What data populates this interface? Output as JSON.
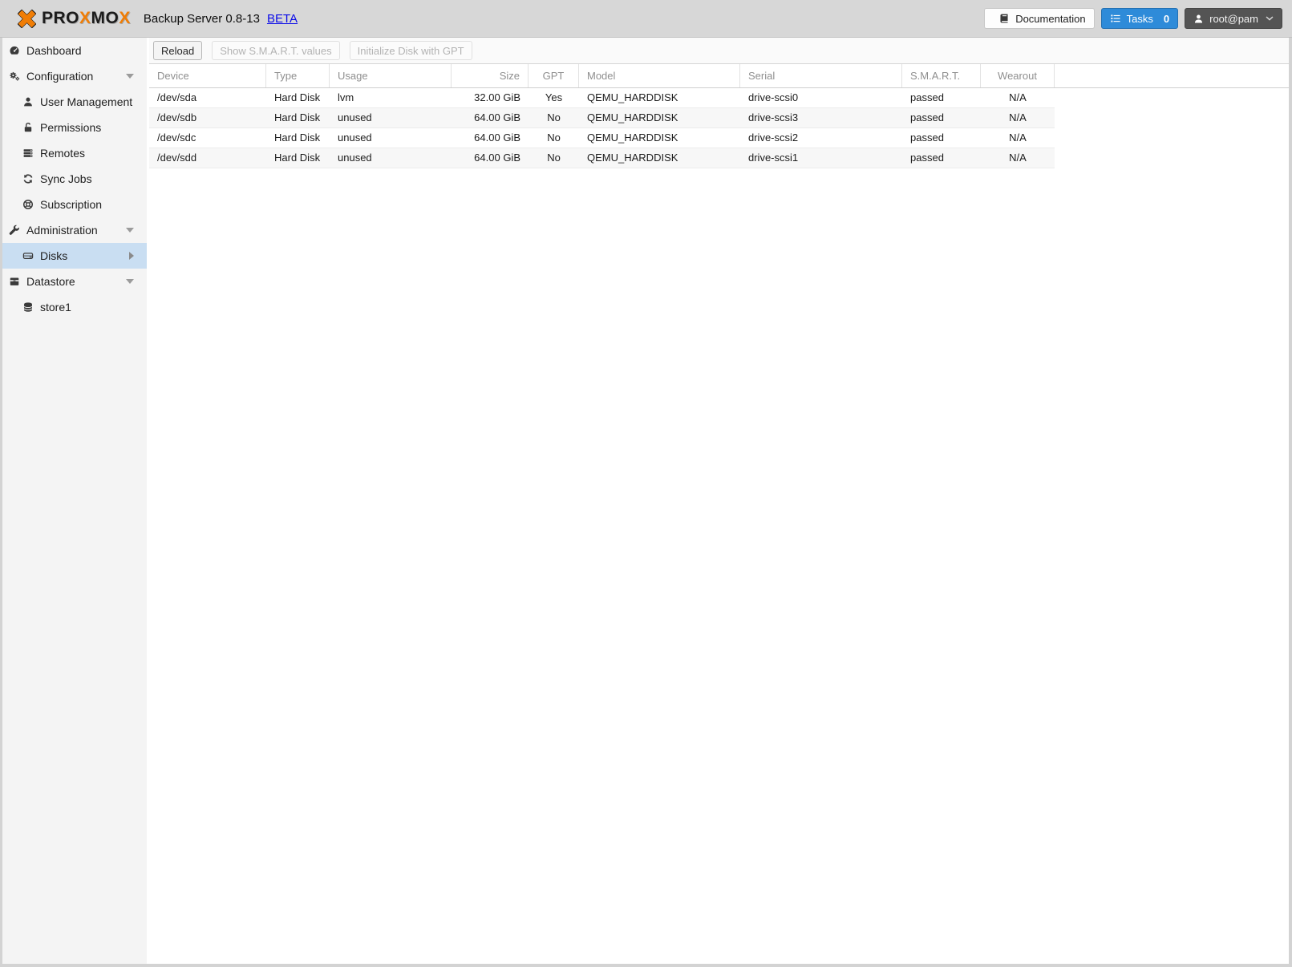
{
  "header": {
    "logo": {
      "p1": "PRO",
      "x1": "X",
      "p2": "MO",
      "x2": "X"
    },
    "title": "Backup Server 0.8-13",
    "beta": "BETA",
    "documentation": "Documentation",
    "tasks": "Tasks",
    "tasks_count": "0",
    "user": "root@pam"
  },
  "sidebar": {
    "items": [
      {
        "label": "Dashboard"
      },
      {
        "label": "Configuration"
      },
      {
        "label": "User Management"
      },
      {
        "label": "Permissions"
      },
      {
        "label": "Remotes"
      },
      {
        "label": "Sync Jobs"
      },
      {
        "label": "Subscription"
      },
      {
        "label": "Administration"
      },
      {
        "label": "Disks"
      },
      {
        "label": "Datastore"
      },
      {
        "label": "store1"
      }
    ]
  },
  "toolbar": {
    "reload": "Reload",
    "show_smart": "Show S.M.A.R.T. values",
    "init_gpt": "Initialize Disk with GPT"
  },
  "table": {
    "columns": [
      "Device",
      "Type",
      "Usage",
      "Size",
      "GPT",
      "Model",
      "Serial",
      "S.M.A.R.T.",
      "Wearout"
    ],
    "rows": [
      {
        "device": "/dev/sda",
        "type": "Hard Disk",
        "usage": "lvm",
        "size": "32.00 GiB",
        "gpt": "Yes",
        "model": "QEMU_HARDDISK",
        "serial": "drive-scsi0",
        "smart": "passed",
        "wearout": "N/A"
      },
      {
        "device": "/dev/sdb",
        "type": "Hard Disk",
        "usage": "unused",
        "size": "64.00 GiB",
        "gpt": "No",
        "model": "QEMU_HARDDISK",
        "serial": "drive-scsi3",
        "smart": "passed",
        "wearout": "N/A"
      },
      {
        "device": "/dev/sdc",
        "type": "Hard Disk",
        "usage": "unused",
        "size": "64.00 GiB",
        "gpt": "No",
        "model": "QEMU_HARDDISK",
        "serial": "drive-scsi2",
        "smart": "passed",
        "wearout": "N/A"
      },
      {
        "device": "/dev/sdd",
        "type": "Hard Disk",
        "usage": "unused",
        "size": "64.00 GiB",
        "gpt": "No",
        "model": "QEMU_HARDDISK",
        "serial": "drive-scsi1",
        "smart": "passed",
        "wearout": "N/A"
      }
    ]
  },
  "colors": {
    "accent_blue": "#2e8bd9",
    "selection_blue": "#c9def2",
    "logo_orange": "#f07d05",
    "smart_passed_text": "#1c1c1c"
  }
}
